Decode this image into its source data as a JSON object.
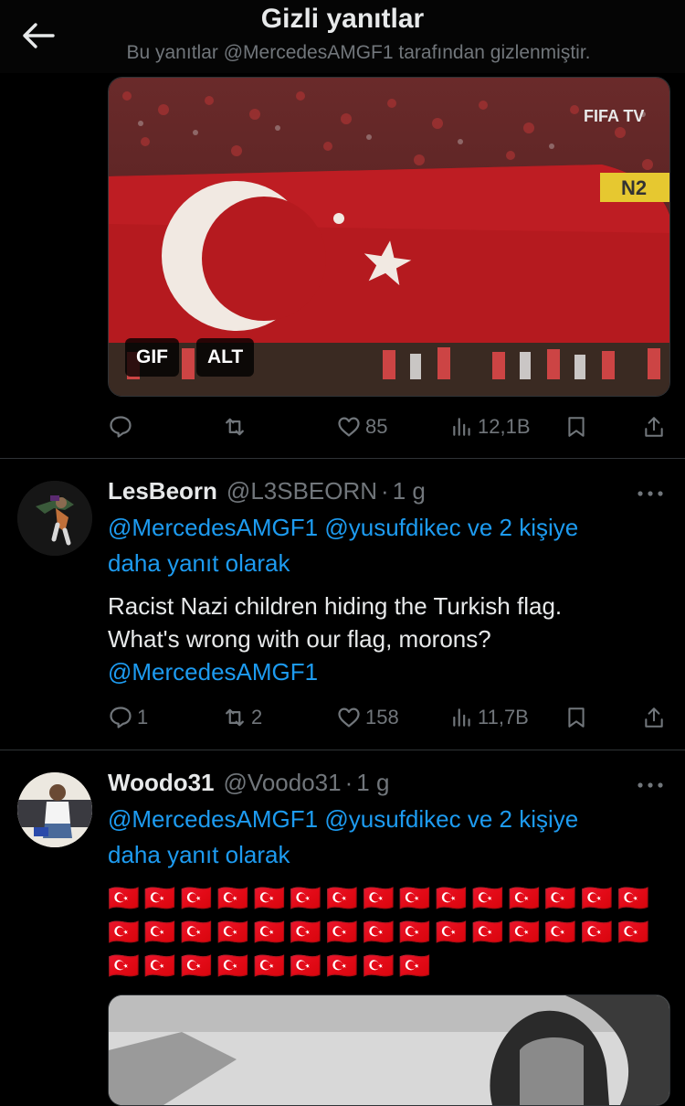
{
  "header": {
    "title": "Gizli yanıtlar",
    "subtitle": "Bu yanıtlar @MercedesAMGF1 tarafından gizlenmiştir."
  },
  "media_card": {
    "watermark": "FIFA TV",
    "banner_text": "N2",
    "gif_badge": "GIF",
    "alt_badge": "ALT"
  },
  "first_tweet_actions": {
    "replies": "",
    "retweets": "",
    "likes": "85",
    "views": "12,1B"
  },
  "tweets": [
    {
      "display_name": "LesBeorn",
      "handle": "@L3SBEORN",
      "separator": "·",
      "time": "1 g",
      "reply_mentions": [
        "@MercedesAMGF1",
        "@yusufdikec"
      ],
      "reply_suffix": "ve 2 kişiye",
      "reply_line2": "daha yanıt olarak",
      "text_line1": "Racist Nazi children hiding the Turkish flag.",
      "text_line2": "What's wrong with our flag, morons?",
      "text_mention": "@MercedesAMGF1",
      "replies": "1",
      "retweets": "2",
      "likes": "158",
      "views": "11,7B"
    },
    {
      "display_name": "Woodo31",
      "handle": "@Voodo31",
      "separator": "·",
      "time": "1 g",
      "reply_mentions": [
        "@MercedesAMGF1",
        "@yusufdikec"
      ],
      "reply_suffix": "ve 2 kişiye",
      "reply_line2": "daha yanıt olarak",
      "flags_line1": "🇹🇷🇹🇷🇹🇷🇹🇷🇹🇷🇹🇷🇹🇷🇹🇷🇹🇷🇹🇷🇹🇷🇹🇷🇹🇷🇹🇷🇹🇷",
      "flags_line2": "🇹🇷🇹🇷🇹🇷🇹🇷🇹🇷🇹🇷🇹🇷🇹🇷🇹🇷🇹🇷🇹🇷🇹🇷🇹🇷🇹🇷🇹🇷",
      "flags_line3": "🇹🇷🇹🇷🇹🇷🇹🇷🇹🇷🇹🇷🇹🇷🇹🇷🇹🇷"
    }
  ],
  "icons": {
    "back": "arrow-left-icon",
    "reply": "speech-bubble-icon",
    "retweet": "retweet-icon",
    "like": "heart-icon",
    "views": "bar-chart-icon",
    "bookmark": "bookmark-icon",
    "share": "share-icon",
    "more": "ellipsis-icon"
  },
  "colors": {
    "background": "#000000",
    "text": "#e7e9ea",
    "muted": "#71767b",
    "link": "#1d9bf0",
    "divider": "#2f3336",
    "flag_red": "#c8102e"
  }
}
